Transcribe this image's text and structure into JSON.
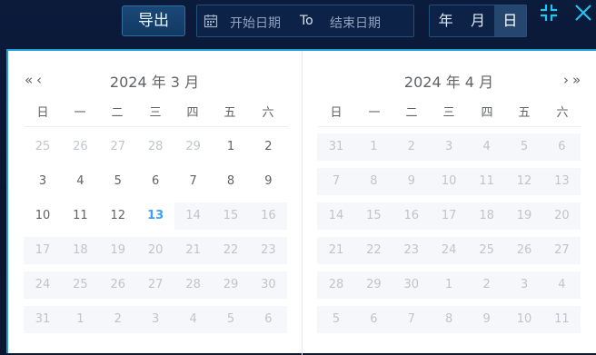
{
  "toolbar": {
    "export_label": "导出",
    "range": {
      "start_placeholder": "开始日期",
      "separator": "To",
      "end_placeholder": "结束日期"
    },
    "units": [
      {
        "label": "年",
        "active": false
      },
      {
        "label": "月",
        "active": false
      },
      {
        "label": "日",
        "active": true
      }
    ],
    "icons": [
      "collapse-icon",
      "close-icon"
    ],
    "accent": "#1f9dd9"
  },
  "calendar": {
    "weekdays": [
      "日",
      "一",
      "二",
      "三",
      "四",
      "五",
      "六"
    ],
    "left": {
      "title": "2024 年 3 月",
      "weeks": [
        [
          {
            "d": "25",
            "s": "prev"
          },
          {
            "d": "26",
            "s": "prev"
          },
          {
            "d": "27",
            "s": "prev"
          },
          {
            "d": "28",
            "s": "prev"
          },
          {
            "d": "29",
            "s": "prev"
          },
          {
            "d": "1",
            "s": "cur"
          },
          {
            "d": "2",
            "s": "cur"
          }
        ],
        [
          {
            "d": "3",
            "s": "cur"
          },
          {
            "d": "4",
            "s": "cur"
          },
          {
            "d": "5",
            "s": "cur"
          },
          {
            "d": "6",
            "s": "cur"
          },
          {
            "d": "7",
            "s": "cur"
          },
          {
            "d": "8",
            "s": "cur"
          },
          {
            "d": "9",
            "s": "cur"
          }
        ],
        [
          {
            "d": "10",
            "s": "cur"
          },
          {
            "d": "11",
            "s": "cur"
          },
          {
            "d": "12",
            "s": "cur"
          },
          {
            "d": "13",
            "s": "today"
          },
          {
            "d": "14",
            "s": "dis"
          },
          {
            "d": "15",
            "s": "dis"
          },
          {
            "d": "16",
            "s": "dis"
          }
        ],
        [
          {
            "d": "17",
            "s": "dis"
          },
          {
            "d": "18",
            "s": "dis"
          },
          {
            "d": "19",
            "s": "dis"
          },
          {
            "d": "20",
            "s": "dis"
          },
          {
            "d": "21",
            "s": "dis"
          },
          {
            "d": "22",
            "s": "dis"
          },
          {
            "d": "23",
            "s": "dis"
          }
        ],
        [
          {
            "d": "24",
            "s": "dis"
          },
          {
            "d": "25",
            "s": "dis"
          },
          {
            "d": "26",
            "s": "dis"
          },
          {
            "d": "27",
            "s": "dis"
          },
          {
            "d": "28",
            "s": "dis"
          },
          {
            "d": "29",
            "s": "dis"
          },
          {
            "d": "30",
            "s": "dis"
          }
        ],
        [
          {
            "d": "31",
            "s": "dis"
          },
          {
            "d": "1",
            "s": "dis"
          },
          {
            "d": "2",
            "s": "dis"
          },
          {
            "d": "3",
            "s": "dis"
          },
          {
            "d": "4",
            "s": "dis"
          },
          {
            "d": "5",
            "s": "dis"
          },
          {
            "d": "6",
            "s": "dis"
          }
        ]
      ]
    },
    "right": {
      "title": "2024 年 4 月",
      "weeks": [
        [
          {
            "d": "31",
            "s": "dis"
          },
          {
            "d": "1",
            "s": "dis"
          },
          {
            "d": "2",
            "s": "dis"
          },
          {
            "d": "3",
            "s": "dis"
          },
          {
            "d": "4",
            "s": "dis"
          },
          {
            "d": "5",
            "s": "dis"
          },
          {
            "d": "6",
            "s": "dis"
          }
        ],
        [
          {
            "d": "7",
            "s": "dis"
          },
          {
            "d": "8",
            "s": "dis"
          },
          {
            "d": "9",
            "s": "dis"
          },
          {
            "d": "10",
            "s": "dis"
          },
          {
            "d": "11",
            "s": "dis"
          },
          {
            "d": "12",
            "s": "dis"
          },
          {
            "d": "13",
            "s": "dis"
          }
        ],
        [
          {
            "d": "14",
            "s": "dis"
          },
          {
            "d": "15",
            "s": "dis"
          },
          {
            "d": "16",
            "s": "dis"
          },
          {
            "d": "17",
            "s": "dis"
          },
          {
            "d": "18",
            "s": "dis"
          },
          {
            "d": "19",
            "s": "dis"
          },
          {
            "d": "20",
            "s": "dis"
          }
        ],
        [
          {
            "d": "21",
            "s": "dis"
          },
          {
            "d": "22",
            "s": "dis"
          },
          {
            "d": "23",
            "s": "dis"
          },
          {
            "d": "24",
            "s": "dis"
          },
          {
            "d": "25",
            "s": "dis"
          },
          {
            "d": "26",
            "s": "dis"
          },
          {
            "d": "27",
            "s": "dis"
          }
        ],
        [
          {
            "d": "28",
            "s": "dis"
          },
          {
            "d": "29",
            "s": "dis"
          },
          {
            "d": "30",
            "s": "dis"
          },
          {
            "d": "1",
            "s": "dis"
          },
          {
            "d": "2",
            "s": "dis"
          },
          {
            "d": "3",
            "s": "dis"
          },
          {
            "d": "4",
            "s": "dis"
          }
        ],
        [
          {
            "d": "5",
            "s": "dis"
          },
          {
            "d": "6",
            "s": "dis"
          },
          {
            "d": "7",
            "s": "dis"
          },
          {
            "d": "8",
            "s": "dis"
          },
          {
            "d": "9",
            "s": "dis"
          },
          {
            "d": "10",
            "s": "dis"
          },
          {
            "d": "11",
            "s": "dis"
          }
        ]
      ]
    },
    "nav": {
      "prev_year": "«",
      "prev_month": "‹",
      "next_month": "›",
      "next_year": "»"
    },
    "today_color": "#409eff"
  }
}
